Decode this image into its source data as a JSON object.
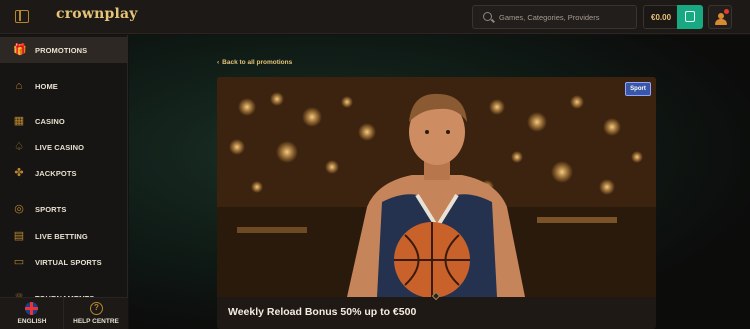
{
  "header": {
    "logo": "crownplay",
    "search_placeholder": "Games, Categories, Providers",
    "balance": "€0.00"
  },
  "sidebar": {
    "items": [
      {
        "label": "PROMOTIONS",
        "icon": "gift-icon",
        "active": true
      },
      {
        "label": "HOME",
        "icon": "home-icon"
      },
      {
        "label": "CASINO",
        "icon": "slots-icon"
      },
      {
        "label": "LIVE CASINO",
        "icon": "spade-icon"
      },
      {
        "label": "JACKPOTS",
        "icon": "clover-icon"
      },
      {
        "label": "SPORTS",
        "icon": "ball-icon"
      },
      {
        "label": "LIVE BETTING",
        "icon": "live-betting-icon"
      },
      {
        "label": "VIRTUAL SPORTS",
        "icon": "gamepad-icon"
      },
      {
        "label": "TOURNAMENTS",
        "icon": "trophy-icon"
      }
    ],
    "footer": {
      "language": "ENGLISH",
      "help": "HELP CENTRE"
    }
  },
  "main": {
    "back_link": "Back to all promotions",
    "badge": "Sport",
    "promo_title": "Weekly Reload Bonus 50% up to €500"
  },
  "colors": {
    "accent_gold": "#e6c477",
    "icon_gold": "#b8862e",
    "wallet_green": "#18a882",
    "badge_blue": "#3a56a8"
  }
}
